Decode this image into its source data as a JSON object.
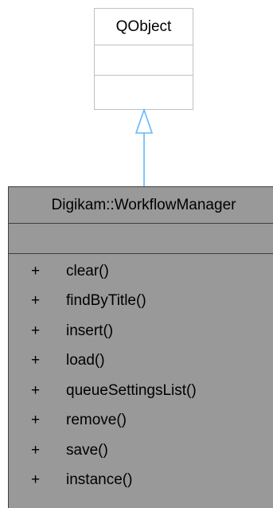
{
  "diagram": {
    "base_class": {
      "name": "QObject"
    },
    "main_class": {
      "name": "Digikam::WorkflowManager",
      "operations": [
        {
          "visibility": "+",
          "name": "clear()"
        },
        {
          "visibility": "+",
          "name": "findByTitle()"
        },
        {
          "visibility": "+",
          "name": "insert()"
        },
        {
          "visibility": "+",
          "name": "load()"
        },
        {
          "visibility": "+",
          "name": "queueSettingsList()"
        },
        {
          "visibility": "+",
          "name": "remove()"
        },
        {
          "visibility": "+",
          "name": "save()"
        },
        {
          "visibility": "+",
          "name": "instance()"
        }
      ]
    },
    "colors": {
      "base_border": "#c0c0c0",
      "main_fill": "#999999",
      "main_border": "#404040",
      "arrow": "#63b8ff"
    }
  }
}
